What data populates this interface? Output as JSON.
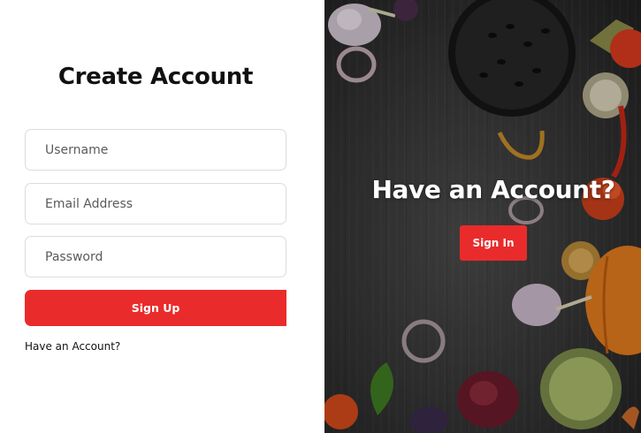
{
  "signup": {
    "title": "Create Account",
    "username_placeholder": "Username",
    "email_placeholder": "Email Address",
    "password_placeholder": "Password",
    "signup_label": "Sign Up",
    "have_account_link": "Have an Account?"
  },
  "panel": {
    "title": "Have an Account?",
    "signin_label": "Sign In"
  },
  "colors": {
    "accent": "#ea2b2b",
    "panel_bg": "#333333",
    "field_border": "#dcdcdc"
  }
}
